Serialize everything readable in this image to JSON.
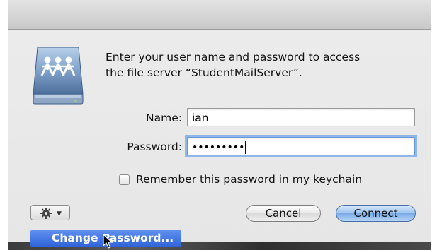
{
  "dialog": {
    "message_line1": "Enter your user name and password to access",
    "message_line2": "the file server “StudentMailServer”.",
    "name_label": "Name:",
    "name_value": "ian",
    "password_label": "Password:",
    "password_masked": "•••••••••",
    "remember_label": "Remember this password in my keychain",
    "remember_checked": false,
    "cancel_label": "Cancel",
    "connect_label": "Connect"
  },
  "action_menu": {
    "icon": "gear-icon",
    "items": [
      {
        "label": "Change Password..."
      }
    ]
  },
  "colors": {
    "accent": "#3a6fdc",
    "focus_ring": "#8fb6e8",
    "dialog_bg": "#ececec"
  }
}
